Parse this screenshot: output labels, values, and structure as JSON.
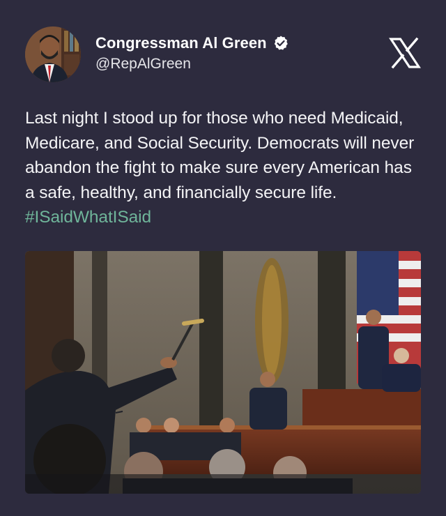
{
  "author": {
    "display_name": "Congressman Al Green",
    "handle": "@RepAlGreen",
    "verified": true,
    "verified_icon": "verified-badge-icon",
    "avatar_icon": "profile-avatar"
  },
  "platform": {
    "logo_icon": "x-logo-icon"
  },
  "tweet": {
    "text": "Last night I stood up for those who need Medicaid, Medicare, and Social Security. Democrats will never abandon the fight to make sure every American has a safe, healthy, and financially secure life. ",
    "hashtag": "#ISaidWhatISaid"
  },
  "media": {
    "type": "photo",
    "image_icon": "tweet-photo"
  },
  "colors": {
    "background": "#2d2b3e",
    "text": "#f4f4f6",
    "hashtag": "#6fb59a",
    "verified_badge": "#ffffff"
  }
}
